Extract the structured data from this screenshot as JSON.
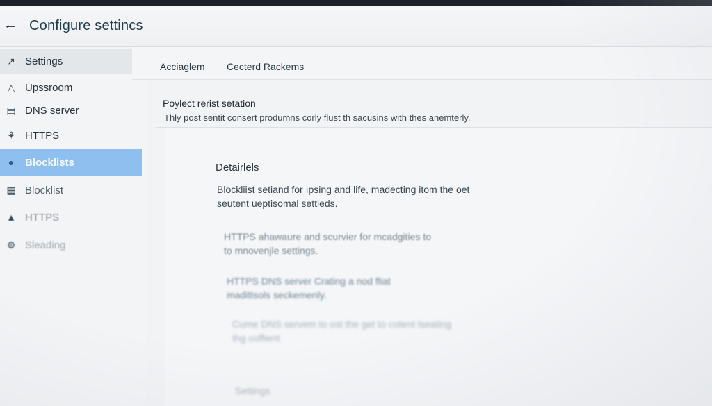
{
  "header": {
    "title": "Configure settincs",
    "back_icon": "arrow-left-icon"
  },
  "sidebar": {
    "items": [
      {
        "label": "Settings",
        "icon": "chevron-icon"
      },
      {
        "label": "Upssroom",
        "icon": "warning-icon"
      },
      {
        "label": "DNS server",
        "icon": "server-icon"
      },
      {
        "label": "HTTPS",
        "icon": "shield-icon"
      },
      {
        "label": "Blocklists",
        "icon": "info-icon"
      },
      {
        "label": "Blocklist",
        "icon": "list-icon"
      },
      {
        "label": "HTTPS",
        "icon": "lock-icon"
      },
      {
        "label": "Sleading",
        "icon": "settings-icon"
      }
    ]
  },
  "tabs": [
    {
      "label": "Acciaglem"
    },
    {
      "label": "Cecterd Rackems"
    }
  ],
  "section": {
    "title": "Poylect rerist setation",
    "description": "Thly post sentit consert produmns corly flust th sacusins with thes anemterly."
  },
  "details": {
    "title": "Detairlels",
    "paragraphs": [
      {
        "line1": "Blockliist setiand for ıpsing and life, madecting itom the oet",
        "line2": "seutent ueptisomal settieds."
      },
      {
        "line1": "HTTPS ahawaure and scurvier for mcadgities to",
        "line2": "to mnovenjle settings."
      },
      {
        "line1": "HTTPS DNS server Crating a nod fliat",
        "line2": "madittsols seckemenly."
      },
      {
        "line1": "Cume DNS servem to ost the get to cotent lseating",
        "line2": "thg coffient"
      }
    ],
    "settings_label": "Settings"
  },
  "colors": {
    "active_item": "#8fbfee",
    "title_color": "#1f3d4d",
    "background": "#eef0f3"
  }
}
